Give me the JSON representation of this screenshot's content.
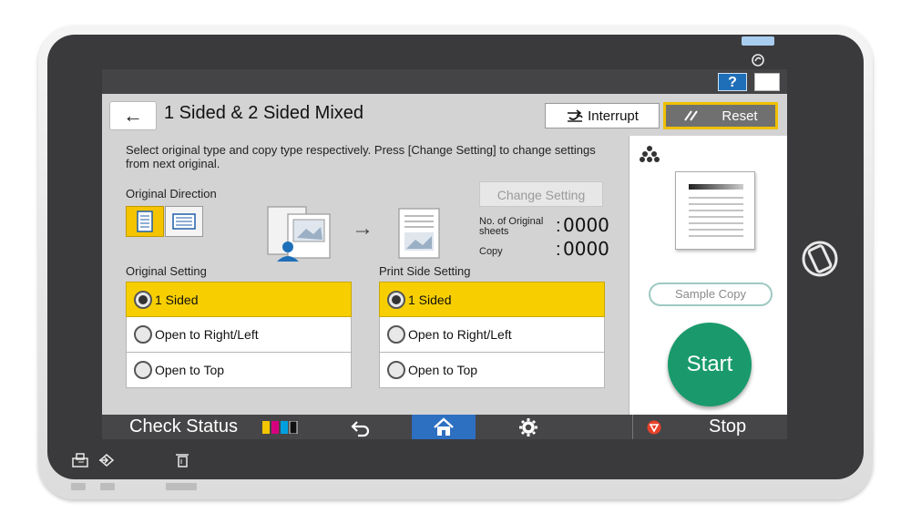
{
  "colors": {
    "accent_yellow": "#f7cf00",
    "start_green": "#1a9a6c",
    "home_blue": "#2d6fc0",
    "help_blue": "#1f6fb8",
    "device_dark": "#3a3a3c"
  },
  "topbar": {
    "help_label": "?",
    "energy_icon": "energy-saver-icon",
    "sleep_icon": "moon-icon"
  },
  "header": {
    "back_icon": "back-arrow-icon",
    "back_label": "←",
    "title": "1 Sided & 2 Sided Mixed",
    "interrupt_label": "Interrupt",
    "reset_label": "Reset"
  },
  "main": {
    "instruction": "Select original type and copy type respectively. Press [Change Setting] to change settings from next original.",
    "original_direction_label": "Original Direction",
    "change_setting_label": "Change Setting",
    "arrow_label": "→",
    "counts": {
      "sheets_label": "No. of Original sheets",
      "sheets_value": "0000",
      "copy_label": "Copy",
      "copy_value": "0000",
      "colon": ":"
    },
    "original_setting": {
      "label": "Original Setting",
      "options": [
        {
          "label": "1 Sided",
          "selected": true
        },
        {
          "label": "Open to Right/Left",
          "selected": false
        },
        {
          "label": "Open to Top",
          "selected": false
        }
      ]
    },
    "print_side_setting": {
      "label": "Print Side Setting",
      "options": [
        {
          "label": "1 Sided",
          "selected": true
        },
        {
          "label": "Open to Right/Left",
          "selected": false
        },
        {
          "label": "Open to Top",
          "selected": false
        }
      ]
    }
  },
  "right_panel": {
    "sample_copy_label": "Sample Copy",
    "start_label": "Start"
  },
  "bottom_bar": {
    "check_status_label": "Check Status",
    "stop_label": "Stop"
  }
}
